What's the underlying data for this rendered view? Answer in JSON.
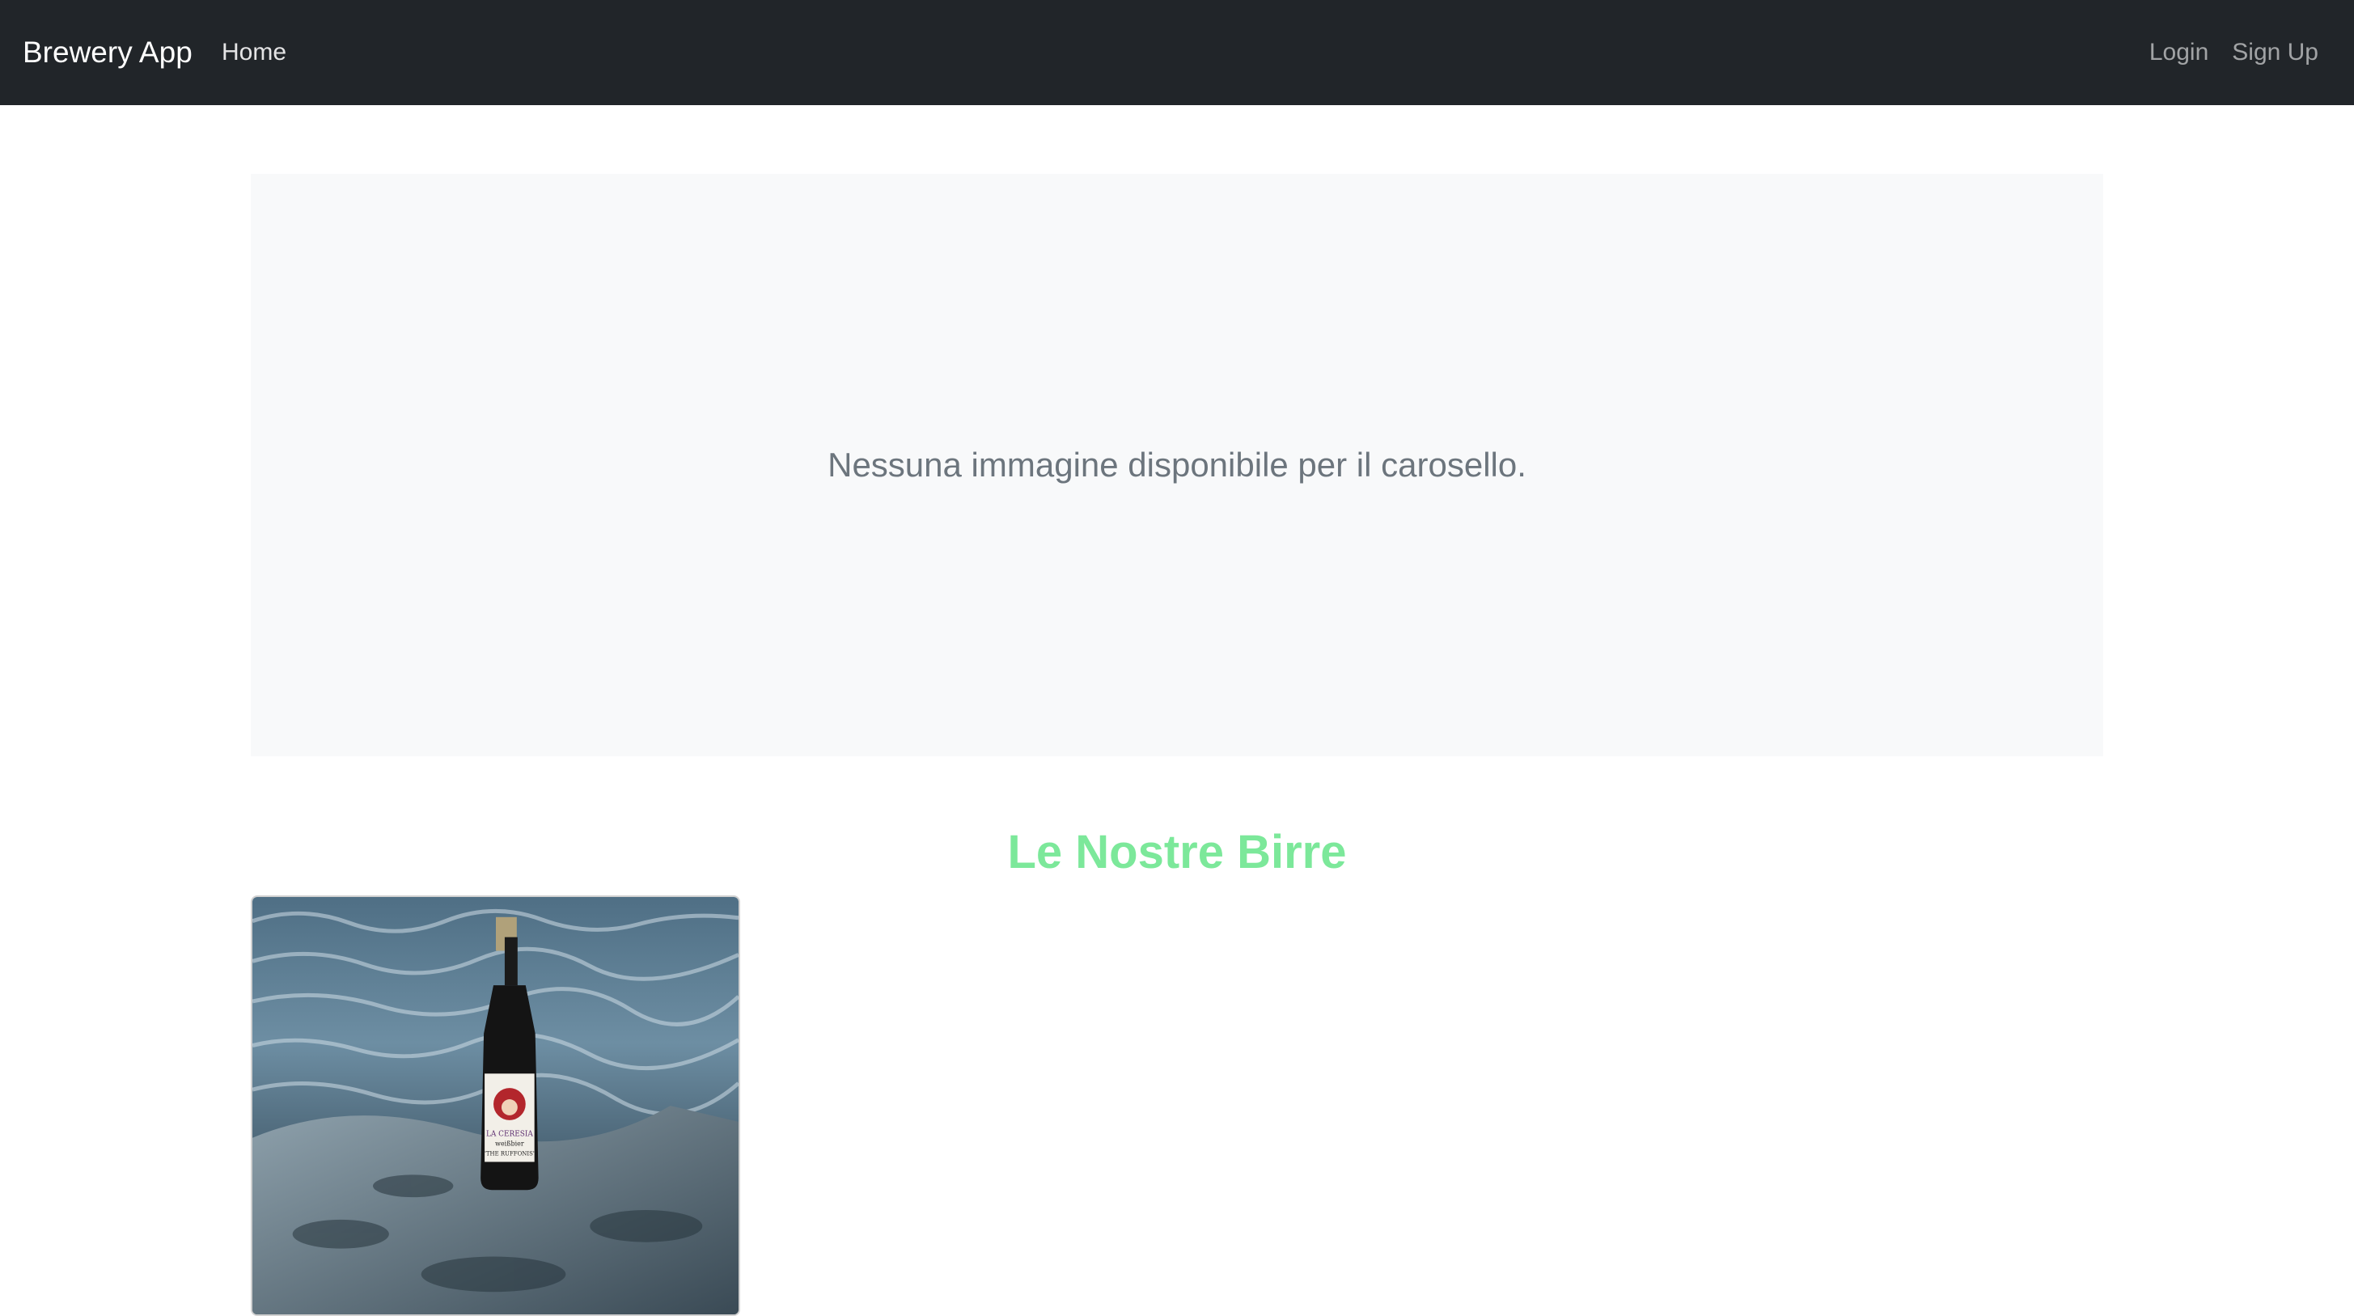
{
  "navbar": {
    "brand": "Brewery App",
    "links_left": [
      "Home"
    ],
    "links_right": [
      "Login",
      "Sign Up"
    ]
  },
  "carousel": {
    "empty_message": "Nessuna immagine disponibile per il carosello."
  },
  "beers": {
    "title": "Le Nostre Birre",
    "items": [
      {
        "label_text": "LA CERESIA",
        "label_sub": "weißbier",
        "label_tag": "\"THE RUFFONIS\""
      }
    ]
  },
  "colors": {
    "navbar_bg": "#212529",
    "carousel_bg": "#f8f9fa",
    "title_accent": "#7ce89a"
  }
}
